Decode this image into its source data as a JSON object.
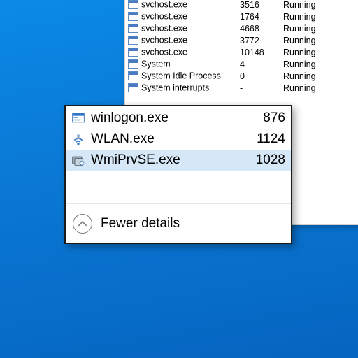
{
  "task_manager": {
    "rows": [
      {
        "name": "svchost.exe",
        "pid": "",
        "status": ""
      },
      {
        "name": "svchost.exe",
        "pid": "3516",
        "status": "Running"
      },
      {
        "name": "svchost.exe",
        "pid": "1764",
        "status": "Running"
      },
      {
        "name": "svchost.exe",
        "pid": "4668",
        "status": "Running"
      },
      {
        "name": "svchost.exe",
        "pid": "3772",
        "status": "Running"
      },
      {
        "name": "svchost.exe",
        "pid": "10148",
        "status": "Running"
      },
      {
        "name": "System",
        "pid": "4",
        "status": "Running"
      },
      {
        "name": "System Idle Process",
        "pid": "0",
        "status": "Running"
      },
      {
        "name": "System interrupts",
        "pid": "-",
        "status": "Running"
      }
    ]
  },
  "popup": {
    "rows": [
      {
        "icon": "app",
        "name": "winlogon.exe",
        "pid": "876",
        "selected": false
      },
      {
        "icon": "wifi",
        "name": "WLAN.exe",
        "pid": "1124",
        "selected": false
      },
      {
        "icon": "wmi",
        "name": "WmiPrvSE.exe",
        "pid": "1028",
        "selected": true
      }
    ],
    "fewer_label": "Fewer details"
  }
}
